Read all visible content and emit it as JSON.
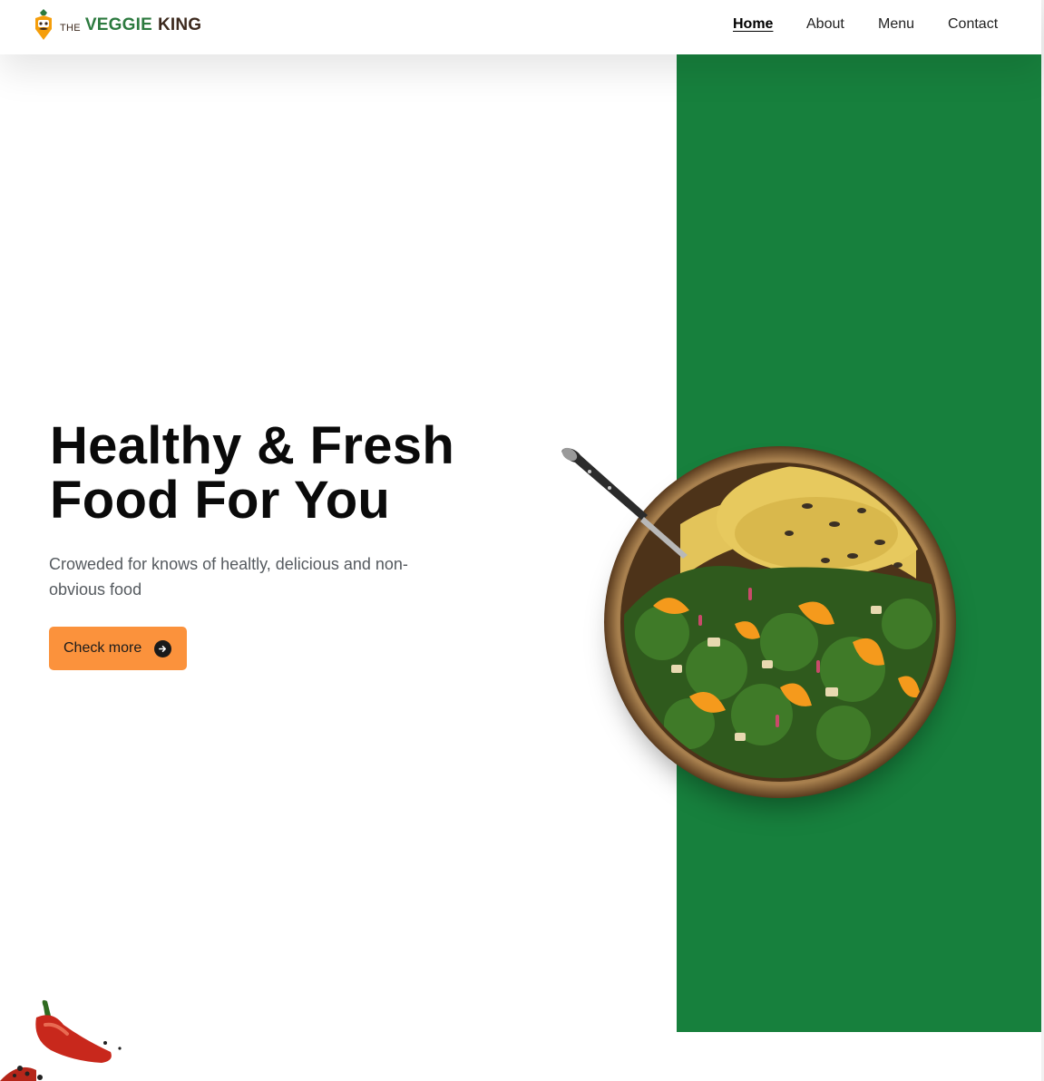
{
  "brand": {
    "the": "THE",
    "veggie": "VEGGIE",
    "king": "KING",
    "icon": "veggie-king-logo-icon",
    "colors": {
      "green": "#2c7a3f",
      "brown": "#3d2a1e",
      "orange": "#f59e0b"
    }
  },
  "nav": {
    "items": [
      {
        "label": "Home",
        "active": true
      },
      {
        "label": "About",
        "active": false
      },
      {
        "label": "Menu",
        "active": false
      },
      {
        "label": "Contact",
        "active": false
      }
    ]
  },
  "hero": {
    "title_line1": "Healthy & Fresh",
    "title_line2": "Food For You",
    "subtitle": "Croweded for knows of healtly, delicious and non-obvious food",
    "cta_label": "Check more",
    "cta_icon": "arrow-right-circle-icon",
    "image": "salad-bowl-with-spoon"
  },
  "decor": {
    "bottom_left_image": "red-chili-pepper"
  },
  "colors": {
    "panel_green": "#17803d",
    "cta_orange": "#fb923c",
    "text_dark": "#0a0a0a",
    "text_muted": "#555a5f"
  }
}
